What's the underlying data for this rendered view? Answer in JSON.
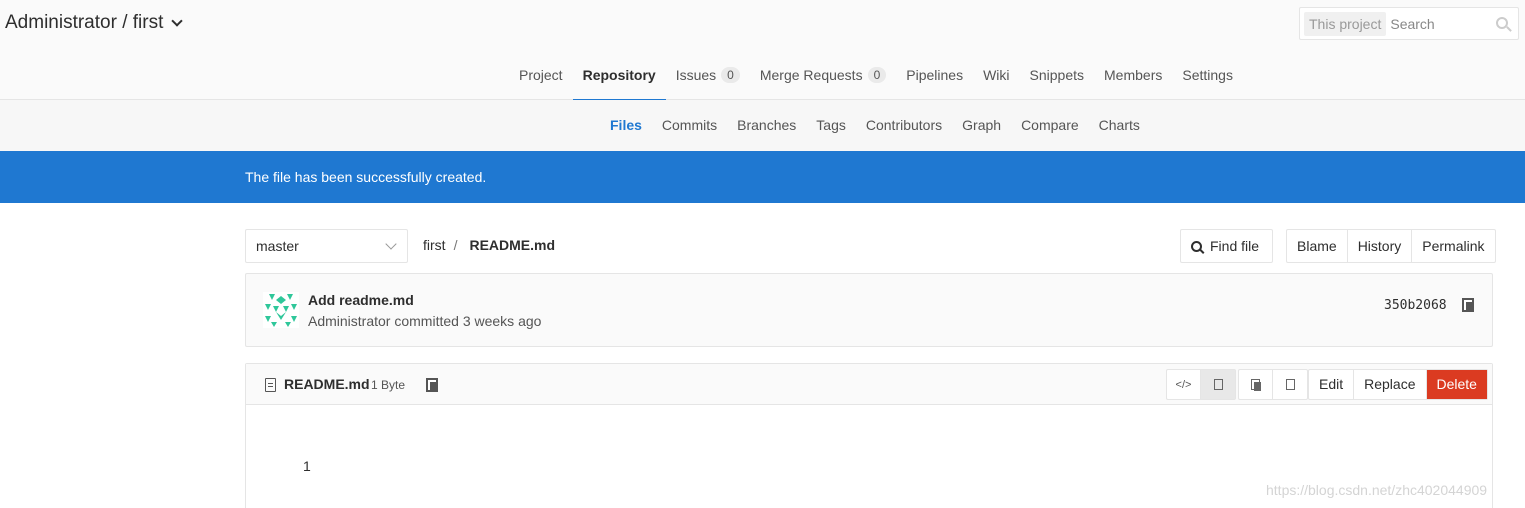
{
  "header": {
    "title": "Administrator / first",
    "search": {
      "scope": "This project",
      "placeholder": "Search"
    }
  },
  "nav": {
    "items": [
      {
        "label": "Project"
      },
      {
        "label": "Repository"
      },
      {
        "label": "Issues",
        "count": "0"
      },
      {
        "label": "Merge Requests",
        "count": "0"
      },
      {
        "label": "Pipelines"
      },
      {
        "label": "Wiki"
      },
      {
        "label": "Snippets"
      },
      {
        "label": "Members"
      },
      {
        "label": "Settings"
      }
    ],
    "active": "Repository"
  },
  "subnav": {
    "items": [
      "Files",
      "Commits",
      "Branches",
      "Tags",
      "Contributors",
      "Graph",
      "Compare",
      "Charts"
    ],
    "active": "Files"
  },
  "flash": {
    "message": "The file has been successfully created."
  },
  "toolbar": {
    "branch": "master",
    "breadcrumb": {
      "project": "first",
      "separator": "/",
      "file": "README.md"
    },
    "find_file": "Find file",
    "buttons": [
      "Blame",
      "History",
      "Permalink"
    ]
  },
  "commit": {
    "message": "Add readme.md",
    "meta": "Administrator committed 3 weeks ago",
    "sha": "350b2068"
  },
  "file": {
    "name": "README.md",
    "size": "1 Byte",
    "actions": {
      "edit": "Edit",
      "replace": "Replace",
      "delete": "Delete"
    },
    "content": "1"
  },
  "watermark": "https://blog.csdn.net/zhc402044909",
  "colors": {
    "accent": "#1f78d1",
    "danger": "#db3b21",
    "avatar": "#2fc79a"
  }
}
